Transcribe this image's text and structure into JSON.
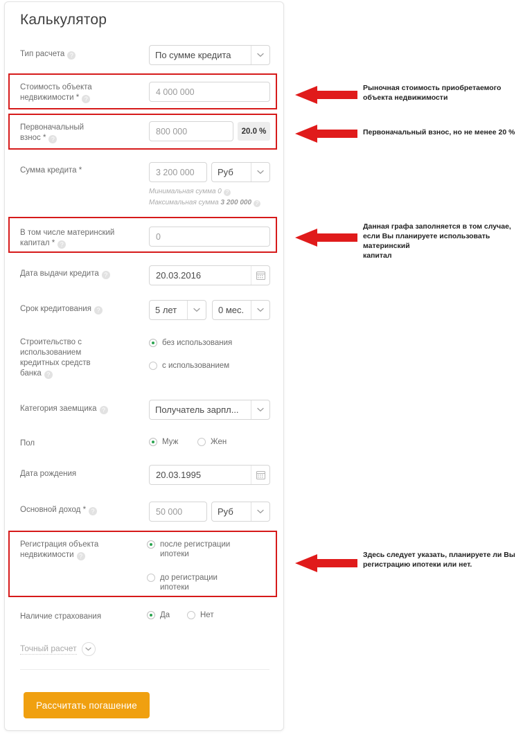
{
  "page_title": "Калькулятор",
  "colors": {
    "accent_button": "#f0a010",
    "highlight_red": "#d61a1a",
    "radio_green": "#2aa44f",
    "label_gray": "#6d6d6d"
  },
  "fields": {
    "calc_type": {
      "label": "Тип расчета",
      "help": "?",
      "value": "По сумме кредита"
    },
    "property_value": {
      "label_line1": "Стоимость объекта",
      "label_line2": "недвижимости *",
      "help": "?",
      "value": "4 000 000"
    },
    "down_payment": {
      "label_line1": "Первоначальный",
      "label_line2": "взнос *",
      "help": "?",
      "value": "800 000",
      "percent": "20.0 %"
    },
    "loan_amount": {
      "label": "Сумма кредита *",
      "value": "3 200 000",
      "currency": "Руб",
      "hint_min": "Минимальная сумма 0",
      "hint_max_prefix": "Максимальная сумма ",
      "hint_max_value": "3 200 000"
    },
    "maternity_capital": {
      "label_line1": "В том числе материнский",
      "label_line2": "капитал *",
      "help": "?",
      "value": "0"
    },
    "issue_date": {
      "label": "Дата выдачи кредита",
      "help": "?",
      "value": "20.03.2016"
    },
    "term": {
      "label": "Срок кредитования",
      "help": "?",
      "years": "5 лет",
      "months": "0 мес."
    },
    "construction": {
      "label_line1": "Строительство с",
      "label_line2": "использованием",
      "label_line3": "кредитных средств",
      "label_line4": "банка",
      "help": "?",
      "options": [
        {
          "label": "без использования",
          "selected": true
        },
        {
          "label": "с использованием",
          "selected": false
        }
      ]
    },
    "borrower_category": {
      "label": "Категория заемщика",
      "help": "?",
      "value": "Получатель зарпл..."
    },
    "gender": {
      "label": "Пол",
      "options": [
        {
          "label": "Муж",
          "selected": true
        },
        {
          "label": "Жен",
          "selected": false
        }
      ]
    },
    "birth_date": {
      "label": "Дата рождения",
      "value": "20.03.1995"
    },
    "main_income": {
      "label": "Основной доход *",
      "help": "?",
      "value": "50 000",
      "currency": "Руб"
    },
    "registration": {
      "label_line1": "Регистрация объекта",
      "label_line2": "недвижимости",
      "help": "?",
      "options": [
        {
          "line1": "после регистрации",
          "line2": "ипотеки",
          "selected": true
        },
        {
          "line1": "до регистрации",
          "line2": "ипотеки",
          "selected": false
        }
      ]
    },
    "insurance": {
      "label": "Наличие страхования",
      "options": [
        {
          "label": "Да",
          "selected": true
        },
        {
          "label": "Нет",
          "selected": false
        }
      ]
    }
  },
  "expander": {
    "label": "Точный расчет"
  },
  "submit": {
    "label": "Рассчитать погашение"
  },
  "annotations": [
    {
      "text": "Рыночная стоимость приобретаемого\nобъекта недвижимости"
    },
    {
      "text": "Первоначальный взнос, но не менее 20 %"
    },
    {
      "text": "Данная графа заполняется в том случае,\nесли Вы планируете использовать материнский\nкапитал"
    },
    {
      "text": "Здесь следует указать, планируете ли Вы\nрегистрацию ипотеки или нет."
    }
  ]
}
